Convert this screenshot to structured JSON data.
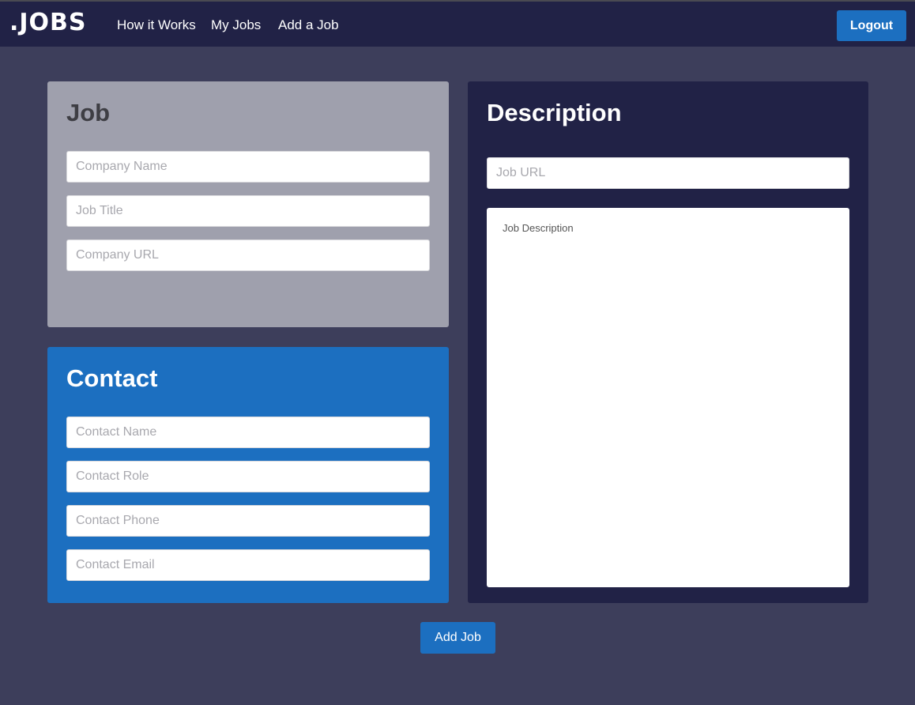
{
  "nav": {
    "logo": ".JOBS",
    "links": [
      "How it Works",
      "My Jobs",
      "Add a Job"
    ],
    "logout_label": "Logout"
  },
  "job_panel": {
    "title": "Job",
    "fields": [
      {
        "placeholder": "Company Name",
        "value": ""
      },
      {
        "placeholder": "Job Title",
        "value": ""
      },
      {
        "placeholder": "Company URL",
        "value": ""
      }
    ]
  },
  "contact_panel": {
    "title": "Contact",
    "fields": [
      {
        "placeholder": "Contact Name",
        "value": ""
      },
      {
        "placeholder": "Contact Role",
        "value": ""
      },
      {
        "placeholder": "Contact Phone",
        "value": ""
      },
      {
        "placeholder": "Contact Email",
        "value": ""
      }
    ]
  },
  "description_panel": {
    "title": "Description",
    "url_placeholder": "Job URL",
    "description_placeholder": "Job Description"
  },
  "submit_label": "Add Job",
  "colors": {
    "navbar": "#212246",
    "background": "#3d3e5b",
    "accent": "#1c6fc0",
    "job_panel": "#9fa0ad"
  }
}
